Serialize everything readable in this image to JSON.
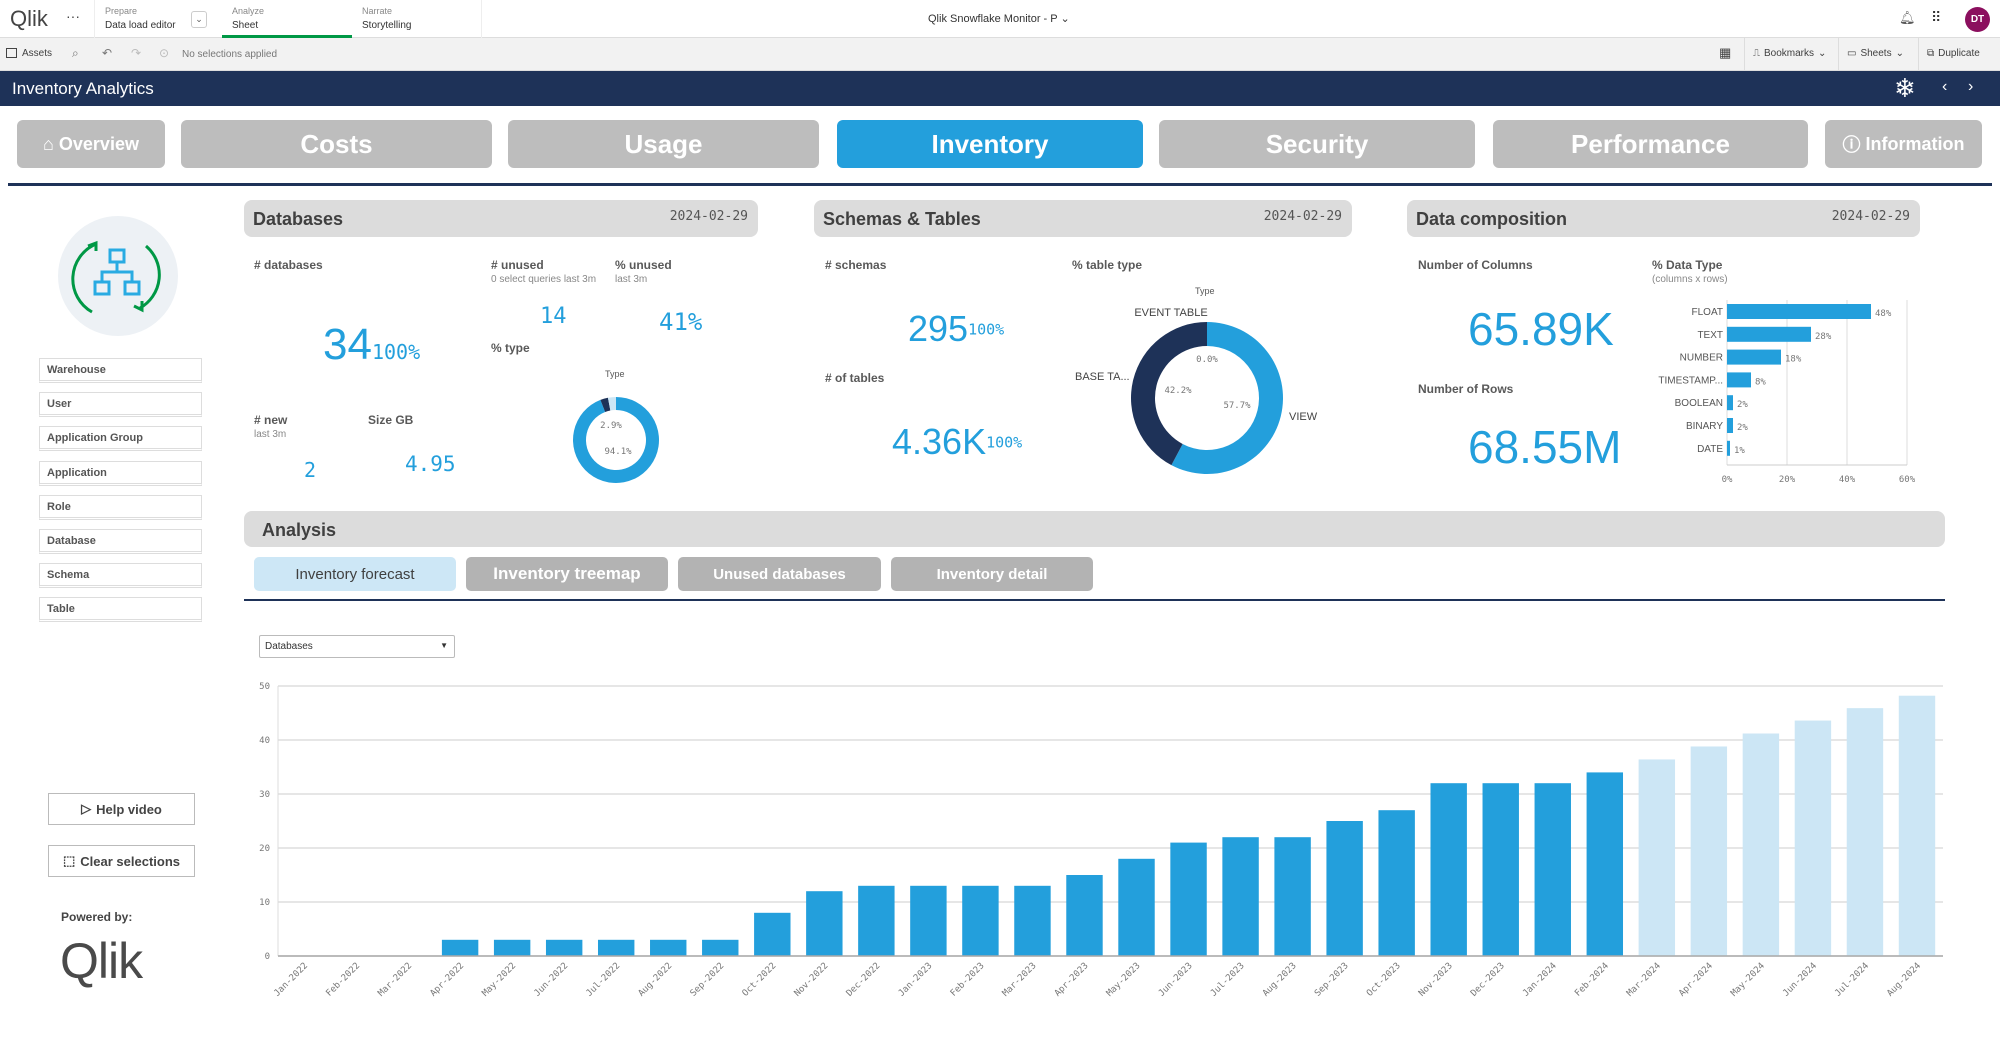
{
  "topbar": {
    "logo": "Qlik",
    "more": "···",
    "prepare_label": "Prepare",
    "prepare_value": "Data load editor",
    "analyze_label": "Analyze",
    "analyze_value": "Sheet",
    "narrate_label": "Narrate",
    "narrate_value": "Storytelling",
    "app_title": "Qlik Snowflake Monitor - P",
    "avatar": "DT"
  },
  "toolbar": {
    "assets": "Assets",
    "selections": "No selections applied",
    "bookmarks": "Bookmarks",
    "sheets": "Sheets",
    "duplicate": "Duplicate"
  },
  "sheet_title": "Inventory Analytics",
  "nav_tabs": [
    {
      "label": "Overview"
    },
    {
      "label": "Costs"
    },
    {
      "label": "Usage"
    },
    {
      "label": "Inventory"
    },
    {
      "label": "Security"
    },
    {
      "label": "Performance"
    },
    {
      "label": "Information"
    }
  ],
  "colors": {
    "accent": "#239fdc",
    "navy": "#1e3258",
    "forecast": "#cce6f5",
    "green": "#009845"
  },
  "filters": [
    "Warehouse",
    "User",
    "Application Group",
    "Application",
    "Role",
    "Database",
    "Schema",
    "Table"
  ],
  "sidebar": {
    "help_video": "Help video",
    "clear_selections": "Clear selections",
    "powered_by": "Powered by:",
    "powered_logo": "Qlik"
  },
  "databases": {
    "title": "Databases",
    "date": "2024-02-29",
    "count_label": "# databases",
    "count": "34",
    "count_pct": "100%",
    "unused_label": "# unused",
    "unused_sub": "0 select queries last 3m",
    "unused": "14",
    "pct_unused_label": "% unused",
    "pct_unused_sub": "last 3m",
    "pct_unused": "41%",
    "type_label": "% type",
    "type_chart_title": "Type",
    "type_slices": [
      {
        "value": 94.1,
        "label": "94.1%",
        "color": "#239fdc"
      },
      {
        "value": 2.9,
        "label": "2.9%",
        "color": "#1e3258"
      },
      {
        "value": 3.0,
        "color": "#cce6f5"
      }
    ],
    "new_label": "# new",
    "new_sub": "last 3m",
    "new": "2",
    "size_label": "Size GB",
    "size": "4.95"
  },
  "schemas": {
    "title": "Schemas & Tables",
    "date": "2024-02-29",
    "schemas_label": "# schemas",
    "schemas": "295",
    "schemas_pct": "100%",
    "tables_label": "# of tables",
    "tables": "4.36K",
    "tables_pct": "100%",
    "table_type_label": "% table type",
    "chart_title": "Type",
    "slices": [
      {
        "name": "VIEW",
        "value": 57.7,
        "label": "57.7%",
        "color": "#239fdc"
      },
      {
        "name": "BASE TA...",
        "value": 42.2,
        "label": "42.2%",
        "color": "#1e3258"
      },
      {
        "name": "EVENT TABLE",
        "value": 0.0,
        "label": "0.0%",
        "color": "#cce6f5"
      }
    ]
  },
  "composition": {
    "title": "Data composition",
    "date": "2024-02-29",
    "columns_label": "Number of Columns",
    "columns": "65.89K",
    "rows_label": "Number of Rows",
    "rows": "68.55M",
    "dtype_label": "% Data Type",
    "dtype_sub": "(columns x rows)"
  },
  "analysis": {
    "title": "Analysis",
    "tabs": [
      "Inventory forecast",
      "Inventory treemap",
      "Unused databases",
      "Inventory detail"
    ],
    "dropdown": "Databases"
  },
  "chart_data": [
    {
      "type": "bar",
      "orientation": "horizontal",
      "categories": [
        "FLOAT",
        "TEXT",
        "NUMBER",
        "TIMESTAMP...",
        "BOOLEAN",
        "BINARY",
        "DATE"
      ],
      "values": [
        48,
        28,
        18,
        8,
        2,
        2,
        1
      ],
      "labels": [
        "48%",
        "28%",
        "18%",
        "8%",
        "2%",
        "2%",
        "1%"
      ],
      "xlim": [
        0,
        60
      ],
      "xticks": [
        "0%",
        "20%",
        "40%",
        "60%"
      ],
      "grid": true
    },
    {
      "type": "bar",
      "categories": [
        "Jan-2022",
        "Feb-2022",
        "Mar-2022",
        "Apr-2022",
        "May-2022",
        "Jun-2022",
        "Jul-2022",
        "Aug-2022",
        "Sep-2022",
        "Oct-2022",
        "Nov-2022",
        "Dec-2022",
        "Jan-2023",
        "Feb-2023",
        "Mar-2023",
        "Apr-2023",
        "May-2023",
        "Jun-2023",
        "Jul-2023",
        "Aug-2023",
        "Sep-2023",
        "Oct-2023",
        "Nov-2023",
        "Dec-2023",
        "Jan-2024",
        "Feb-2024",
        "Mar-2024",
        "Apr-2024",
        "May-2024",
        "Jun-2024",
        "Jul-2024",
        "Aug-2024"
      ],
      "series": [
        {
          "values": [
            0,
            0,
            0,
            3,
            3,
            3,
            3,
            3,
            3,
            8,
            12,
            13,
            13,
            13,
            13,
            15,
            18,
            21,
            22,
            22,
            25,
            27,
            32,
            32,
            32,
            34,
            null,
            null,
            null,
            null,
            null,
            null
          ],
          "color": "#239fdc"
        },
        {
          "values": [
            null,
            null,
            null,
            null,
            null,
            null,
            null,
            null,
            null,
            null,
            null,
            null,
            null,
            null,
            null,
            null,
            null,
            null,
            null,
            null,
            null,
            null,
            null,
            null,
            null,
            null,
            36.4,
            38.8,
            41.2,
            43.6,
            45.9,
            48.2
          ],
          "color": "#cce6f5"
        }
      ],
      "ylim": [
        0,
        50
      ],
      "yticks": [
        0,
        10,
        20,
        30,
        40,
        50
      ],
      "grid": true
    }
  ]
}
